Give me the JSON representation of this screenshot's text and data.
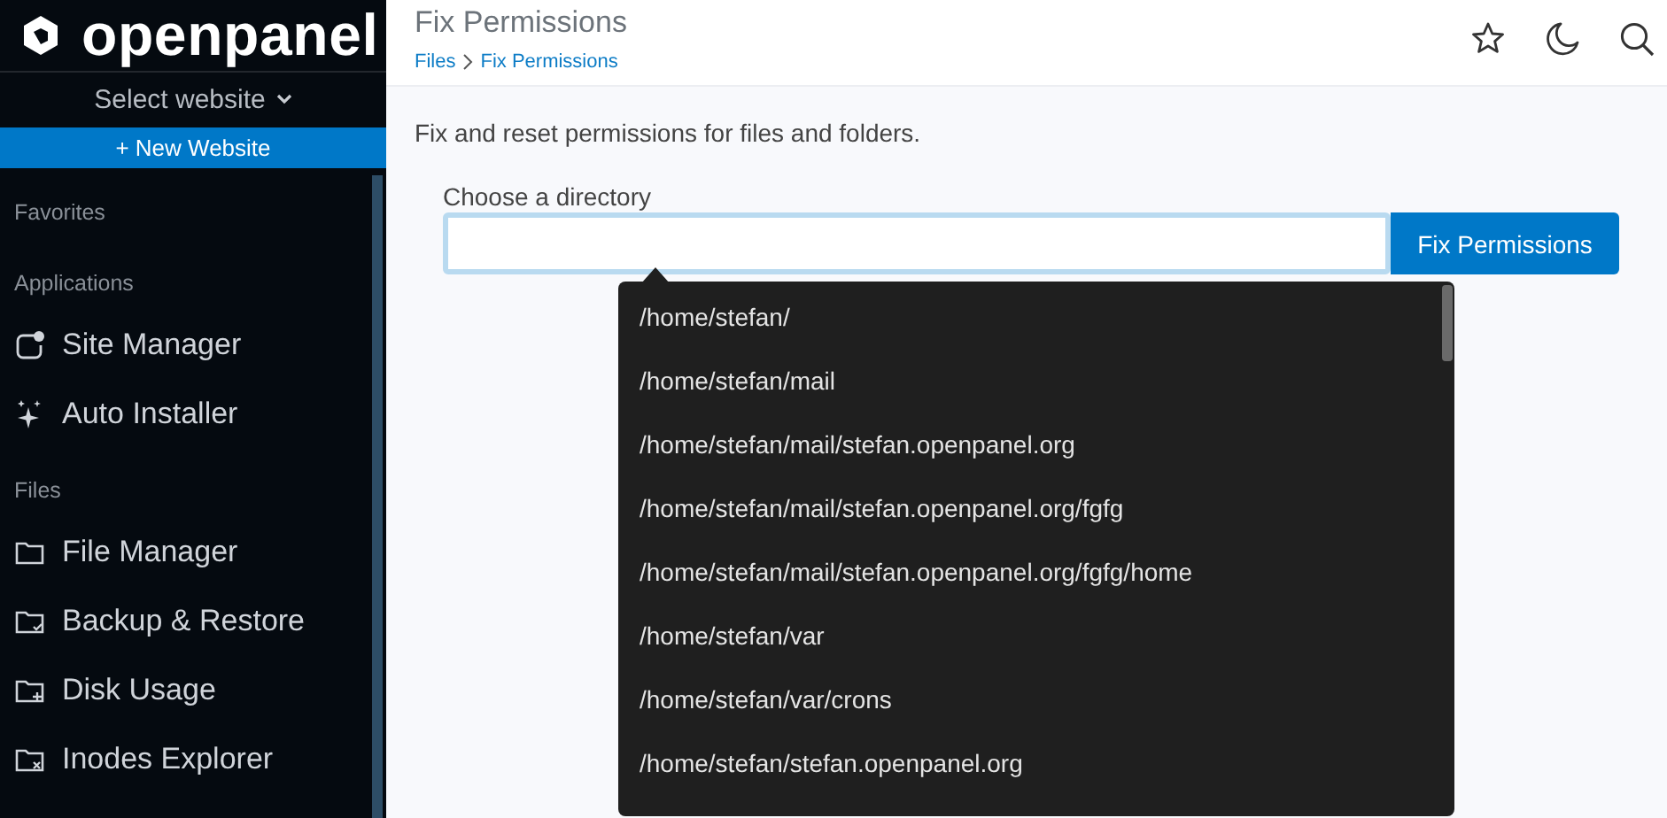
{
  "sidebar": {
    "brand": "openpanel",
    "website_select": "Select website",
    "new_website_button": "+ New Website",
    "sections": [
      {
        "title": "Favorites"
      },
      {
        "title": "Applications",
        "items": [
          {
            "label": "Site Manager",
            "kind": "site"
          },
          {
            "label": "Auto Installer",
            "kind": "sparkle"
          }
        ]
      },
      {
        "title": "Files",
        "items": [
          {
            "label": "File Manager",
            "kind": "folder"
          },
          {
            "label": "Backup & Restore",
            "kind": "folder-check"
          },
          {
            "label": "Disk Usage",
            "kind": "folder-plus"
          },
          {
            "label": "Inodes Explorer",
            "kind": "folder-x"
          }
        ]
      }
    ]
  },
  "header": {
    "title": "Fix Permissions",
    "breadcrumbs": [
      "Files",
      "Fix Permissions"
    ]
  },
  "description": "Fix and reset permissions for files and folders.",
  "directory_field": {
    "label": "Choose a directory",
    "button": "Fix Permissions"
  },
  "suggestions": [
    "/home/stefan/",
    "/home/stefan/mail",
    "/home/stefan/mail/stefan.openpanel.org",
    "/home/stefan/mail/stefan.openpanel.org/fgfg",
    "/home/stefan/mail/stefan.openpanel.org/fgfg/home",
    "/home/stefan/var",
    "/home/stefan/var/crons",
    "/home/stefan/stefan.openpanel.org"
  ]
}
